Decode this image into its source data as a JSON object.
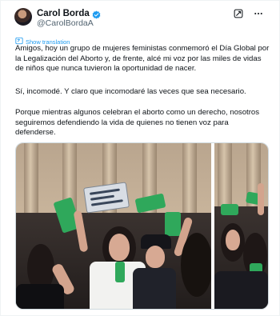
{
  "author": {
    "display_name": "Carol Borda",
    "handle": "@CarolBordaA"
  },
  "icons": {
    "verified": "verified-badge-icon",
    "grok": "grok-icon",
    "more": "more-icon",
    "translate": "translate-icon"
  },
  "colors": {
    "accent": "#1d9bf0",
    "verified": "#1d9bf0",
    "green_scarf": "#2fa85b"
  },
  "translate_label": "Show translation",
  "paragraphs": [
    "Amigos, hoy un grupo de mujeres feministas conmemoró el Día Global por la Legalización del Aborto y, de frente, alcé mi voz por las miles de vidas de niños que nunca tuvieron la oportunidad de nacer.",
    "Sí, incomodé. Y claro que incomodaré las veces que sea necesario.",
    "Porque mientras algunos celebran el aborto como un derecho, nosotros seguiremos defendiendo la vida de quienes no tienen voz para defenderse."
  ],
  "media": {
    "photos": [
      "protest-photo-main",
      "protest-photo-side"
    ]
  }
}
